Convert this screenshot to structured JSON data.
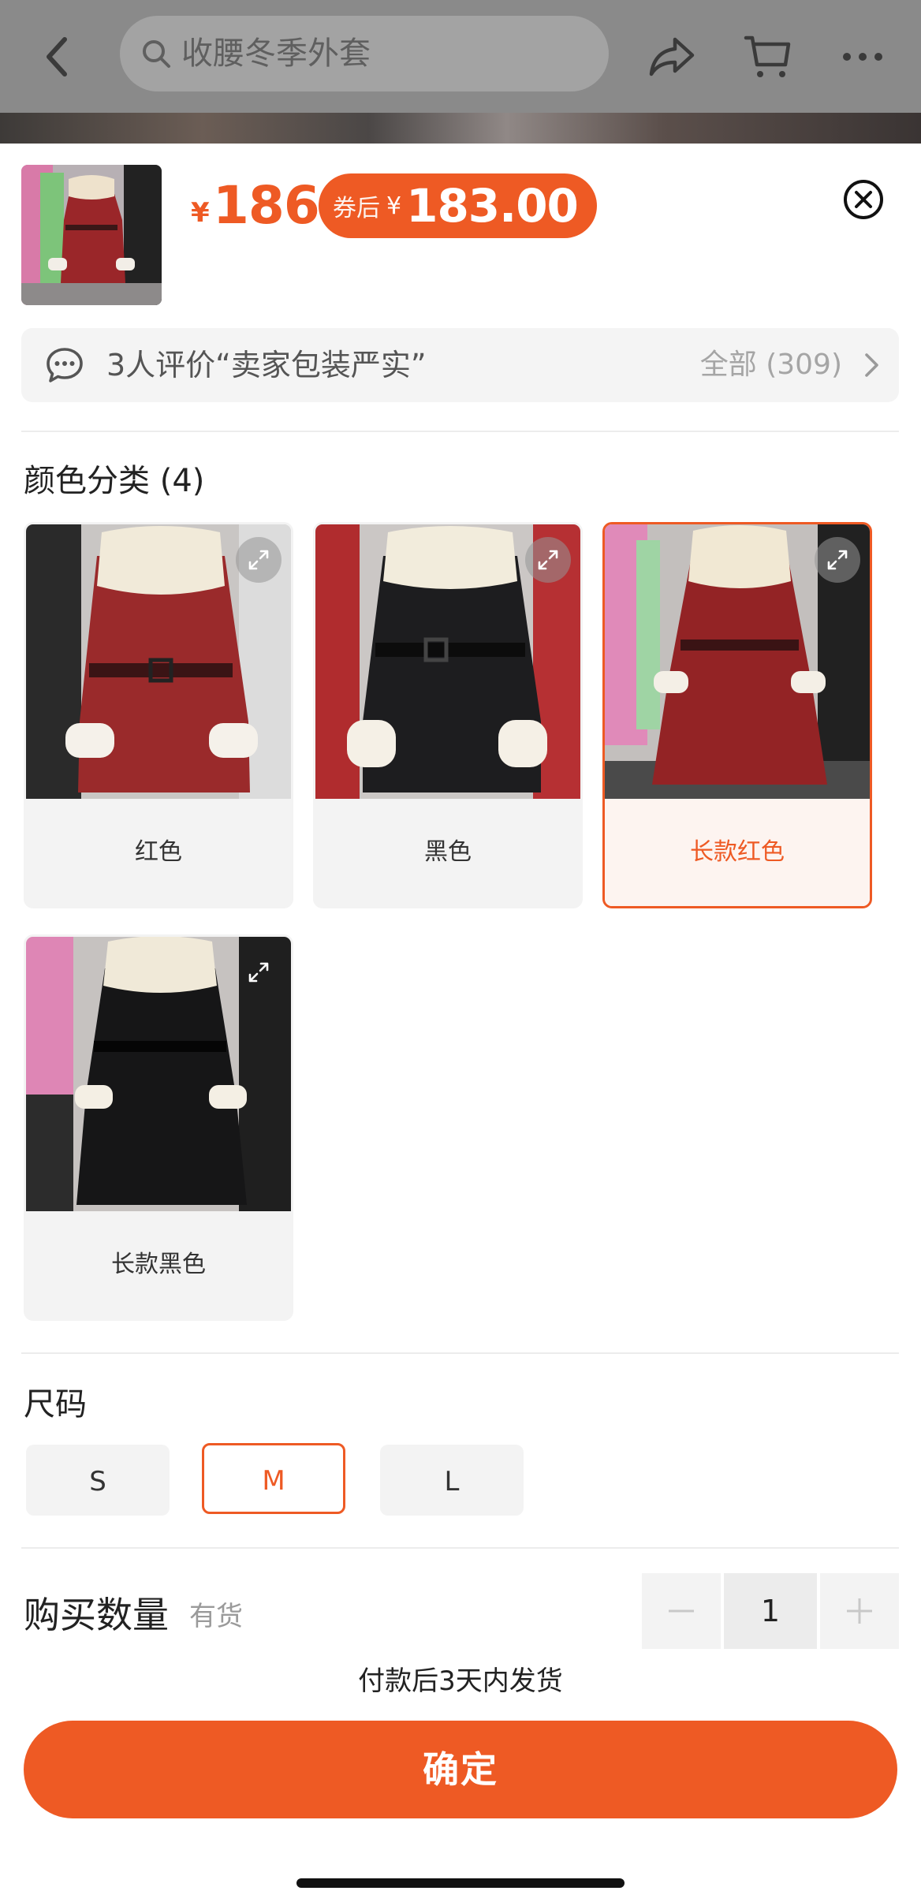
{
  "header": {
    "search_placeholder": "收腰冬季外套",
    "icons": [
      "back-icon",
      "search-icon",
      "share-icon",
      "cart-icon",
      "more-icon"
    ]
  },
  "sheet": {
    "price_symbol": "¥",
    "price": "186",
    "coupon_label": "券后",
    "coupon_symbol": "¥",
    "coupon_price": "183.00",
    "review_text": "3人评价“卖家包装严实”",
    "review_all": "全部 (309)"
  },
  "color_section": {
    "title": "颜色分类 (4)",
    "options": [
      {
        "label": "红色",
        "coat": "#9a2a2b",
        "selected": false
      },
      {
        "label": "黑色",
        "coat": "#1c1c1e",
        "selected": false
      },
      {
        "label": "长款红色",
        "coat": "#922426",
        "selected": true
      },
      {
        "label": "长款黑色",
        "coat": "#171718",
        "selected": false
      }
    ]
  },
  "size_section": {
    "title": "尺码",
    "options": [
      {
        "label": "S",
        "selected": false
      },
      {
        "label": "M",
        "selected": true
      },
      {
        "label": "L",
        "selected": false
      }
    ]
  },
  "quantity": {
    "label": "购买数量",
    "stock": "有货",
    "value": "1"
  },
  "shipping_note": "付款后3天内发货",
  "confirm_label": "确定",
  "colors": {
    "accent": "#ee5a24",
    "selected_bg": "#fdf4f0",
    "option_bg": "#f3f3f3"
  }
}
